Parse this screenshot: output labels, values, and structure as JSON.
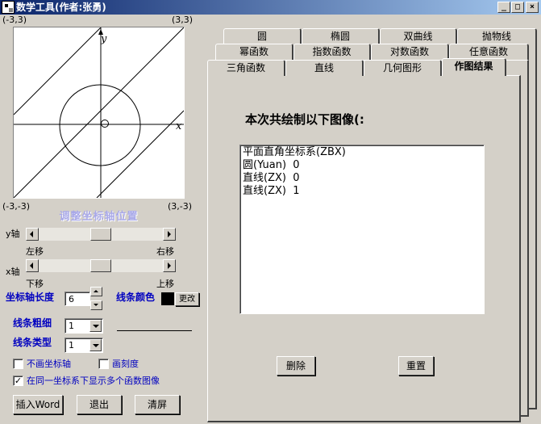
{
  "window": {
    "title": "数学工具(作者:张勇)",
    "minimize_glyph": "_",
    "maximize_glyph": "□",
    "close_glyph": "×"
  },
  "plot": {
    "corner_top_left": "(-3,3)",
    "corner_top_right": "(3,3)",
    "corner_bottom_left": "(-3,-3)",
    "corner_bottom_right": "(3,-3)",
    "axis_x_label": "x",
    "axis_y_label": "y",
    "origin_label": "O"
  },
  "axis_controls": {
    "title": "调整坐标轴位置",
    "y_axis_label": "y轴",
    "move_left": "左移",
    "move_right": "右移",
    "x_axis_label": "x轴",
    "move_down": "下移",
    "move_up": "上移"
  },
  "axis_length": {
    "label": "坐标轴长度",
    "value": "6"
  },
  "line_color": {
    "label": "线条颜色",
    "change_button": "更改",
    "color": "#000000"
  },
  "line_width": {
    "label": "线条粗细",
    "value": "1"
  },
  "line_type": {
    "label": "线条类型",
    "value": "1"
  },
  "options": {
    "no_axis": {
      "label": "不画坐标轴",
      "checked": false
    },
    "draw_ticks": {
      "label": "画刻度",
      "checked": false
    },
    "multi_graph": {
      "label": "在同一坐标系下显示多个函数图像",
      "checked": true
    }
  },
  "bottom_buttons": {
    "insert_word": "插入Word",
    "exit": "退出",
    "clear": "清屏"
  },
  "tabs": {
    "row1": [
      "圆",
      "椭圆",
      "双曲线",
      "抛物线"
    ],
    "row2": [
      "幂函数",
      "指数函数",
      "对数函数",
      "任意函数"
    ],
    "row3": [
      "三角函数",
      "直线",
      "几何图形",
      "作图结果"
    ]
  },
  "result": {
    "heading": "本次共绘制以下图像(:",
    "items": [
      "平面直角坐标系(ZBX)",
      "圆(Yuan)  0",
      "直线(ZX)  0",
      "直线(ZX)  1"
    ],
    "delete_button": "删除",
    "reset_button": "重置"
  },
  "colors": {
    "title_bar": "#0a246a",
    "panel": "#d4d0c8",
    "label_blue": "#0000c0",
    "adjust_title": "#a8a8e8"
  }
}
